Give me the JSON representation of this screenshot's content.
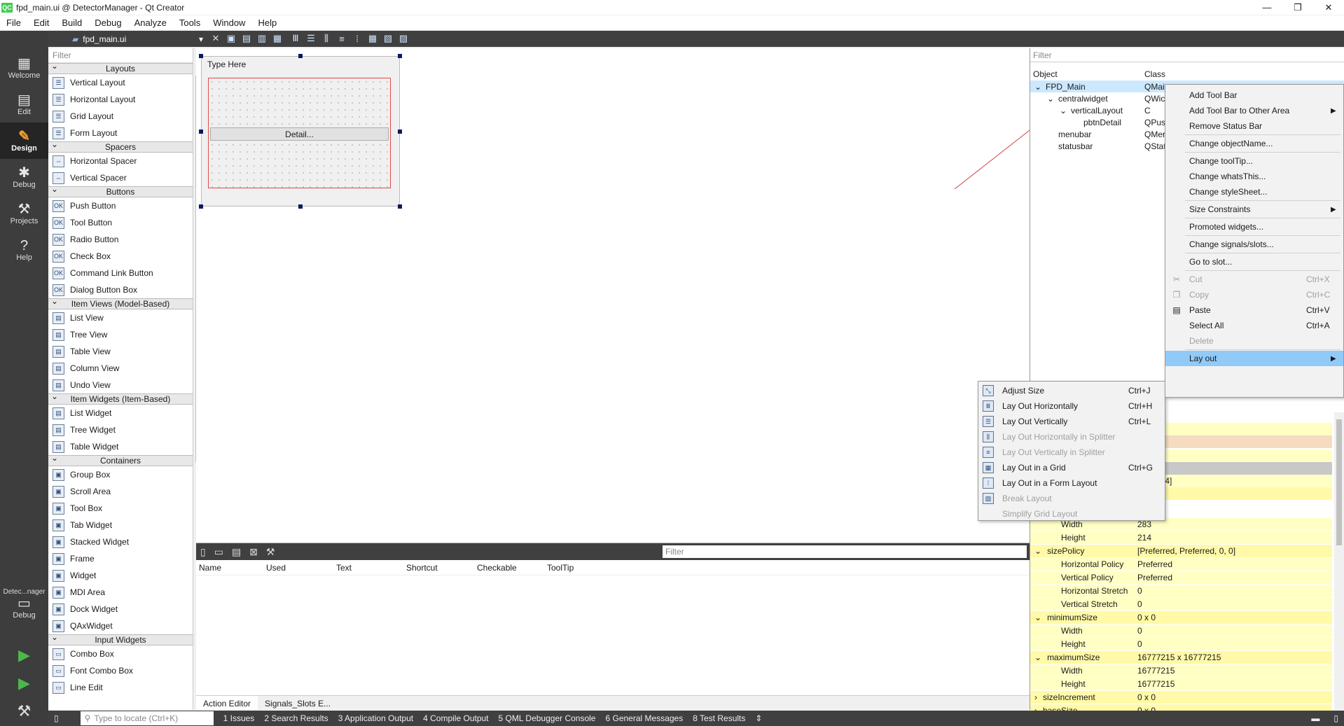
{
  "window": {
    "title": "fpd_main.ui @ DetectorManager - Qt Creator",
    "controls": [
      "—",
      "❐",
      "✕"
    ]
  },
  "menubar": [
    "File",
    "Edit",
    "Build",
    "Debug",
    "Analyze",
    "Tools",
    "Window",
    "Help"
  ],
  "modes": [
    {
      "label": "Welcome",
      "icon": "grid-icon"
    },
    {
      "label": "Edit",
      "icon": "edit-doc-icon"
    },
    {
      "label": "Design",
      "icon": "pencil-icon",
      "active": true
    },
    {
      "label": "Debug",
      "icon": "bug-icon"
    },
    {
      "label": "Projects",
      "icon": "wrench-icon"
    },
    {
      "label": "Help",
      "icon": "help-icon"
    }
  ],
  "kit": {
    "name": "Detec...nager",
    "mode": "Debug"
  },
  "editor": {
    "file_tab": "fpd_main.ui"
  },
  "widgetbox": {
    "filter_placeholder": "Filter",
    "categories": [
      {
        "name": "Layouts",
        "items": [
          "Vertical Layout",
          "Horizontal Layout",
          "Grid Layout",
          "Form Layout"
        ]
      },
      {
        "name": "Spacers",
        "items": [
          "Horizontal Spacer",
          "Vertical Spacer"
        ]
      },
      {
        "name": "Buttons",
        "items": [
          "Push Button",
          "Tool Button",
          "Radio Button",
          "Check Box",
          "Command Link Button",
          "Dialog Button Box"
        ]
      },
      {
        "name": "Item Views (Model-Based)",
        "items": [
          "List View",
          "Tree View",
          "Table View",
          "Column View",
          "Undo View"
        ]
      },
      {
        "name": "Item Widgets (Item-Based)",
        "items": [
          "List Widget",
          "Tree Widget",
          "Table Widget"
        ]
      },
      {
        "name": "Containers",
        "items": [
          "Group Box",
          "Scroll Area",
          "Tool Box",
          "Tab Widget",
          "Stacked Widget",
          "Frame",
          "Widget",
          "MDI Area",
          "Dock Widget",
          "QAxWidget"
        ]
      },
      {
        "name": "Input Widgets",
        "items": [
          "Combo Box",
          "Font Combo Box",
          "Line Edit"
        ]
      }
    ]
  },
  "form": {
    "menu_placeholder": "Type Here",
    "button_text": "Detail..."
  },
  "action_editor": {
    "filter_placeholder": "Filter",
    "columns": [
      "Name",
      "Used",
      "Text",
      "Shortcut",
      "Checkable",
      "ToolTip"
    ],
    "tabs": [
      "Action Editor",
      "Signals_Slots E..."
    ]
  },
  "object_inspector": {
    "filter_placeholder": "Filter",
    "headers": [
      "Object",
      "Class"
    ],
    "rows": [
      {
        "name": "FPD_Main",
        "class": "QMai",
        "indent": 0,
        "expander": "⌄"
      },
      {
        "name": "centralwidget",
        "class": "QWic",
        "indent": 1,
        "expander": "⌄"
      },
      {
        "name": "verticalLayout",
        "class": "C",
        "indent": 2,
        "expander": "⌄"
      },
      {
        "name": "pbtnDetail",
        "class": "QPus",
        "indent": 3,
        "expander": ""
      },
      {
        "name": "menubar",
        "class": "QMer",
        "indent": 1,
        "expander": ""
      },
      {
        "name": "statusbar",
        "class": "QStat",
        "indent": 1,
        "expander": ""
      }
    ]
  },
  "property_editor": {
    "partial": [
      "in",
      "83 x 214]"
    ],
    "rows": [
      {
        "name": "Width",
        "value": "283",
        "level": 2
      },
      {
        "name": "Height",
        "value": "214",
        "level": 2
      },
      {
        "name": "sizePolicy",
        "value": "[Preferred, Preferred, 0, 0]",
        "level": 1,
        "expander": "⌄"
      },
      {
        "name": "Horizontal Policy",
        "value": "Preferred",
        "level": 2
      },
      {
        "name": "Vertical Policy",
        "value": "Preferred",
        "level": 2
      },
      {
        "name": "Horizontal Stretch",
        "value": "0",
        "level": 2
      },
      {
        "name": "Vertical Stretch",
        "value": "0",
        "level": 2
      },
      {
        "name": "minimumSize",
        "value": "0 x 0",
        "level": 1,
        "expander": "⌄"
      },
      {
        "name": "Width",
        "value": "0",
        "level": 2
      },
      {
        "name": "Height",
        "value": "0",
        "level": 2
      },
      {
        "name": "maximumSize",
        "value": "16777215 x 16777215",
        "level": 1,
        "expander": "⌄"
      },
      {
        "name": "Width",
        "value": "16777215",
        "level": 2
      },
      {
        "name": "Height",
        "value": "16777215",
        "level": 2
      },
      {
        "name": "sizeIncrement",
        "value": "0 x 0",
        "level": 1,
        "expander": "›"
      },
      {
        "name": "baseSize",
        "value": "0 x 0",
        "level": 1,
        "expander": "›"
      }
    ]
  },
  "context_menu": {
    "items": [
      {
        "label": "Add Tool Bar"
      },
      {
        "label": "Add Tool Bar to Other Area",
        "submenu": true
      },
      {
        "label": "Remove Status Bar"
      },
      {
        "sep": true
      },
      {
        "label": "Change objectName..."
      },
      {
        "sep": true
      },
      {
        "label": "Change toolTip..."
      },
      {
        "label": "Change whatsThis..."
      },
      {
        "label": "Change styleSheet..."
      },
      {
        "sep": true
      },
      {
        "label": "Size Constraints",
        "submenu": true
      },
      {
        "sep": true
      },
      {
        "label": "Promoted widgets..."
      },
      {
        "sep": true
      },
      {
        "label": "Change signals/slots..."
      },
      {
        "sep": true
      },
      {
        "label": "Go to slot..."
      },
      {
        "sep": true
      },
      {
        "label": "Cut",
        "shortcut": "Ctrl+X",
        "disabled": true,
        "icon": "scissors-icon"
      },
      {
        "label": "Copy",
        "shortcut": "Ctrl+C",
        "disabled": true,
        "icon": "copy-icon"
      },
      {
        "label": "Paste",
        "shortcut": "Ctrl+V",
        "icon": "paste-icon"
      },
      {
        "label": "Select All",
        "shortcut": "Ctrl+A"
      },
      {
        "label": "Delete",
        "disabled": true
      },
      {
        "sep": true
      },
      {
        "label": "Lay out",
        "submenu": true,
        "selected": true
      }
    ]
  },
  "layout_submenu": {
    "items": [
      {
        "label": "Adjust Size",
        "shortcut": "Ctrl+J",
        "icon": "adjust-size-icon"
      },
      {
        "label": "Lay Out Horizontally",
        "shortcut": "Ctrl+H",
        "icon": "hlayout-icon"
      },
      {
        "label": "Lay Out Vertically",
        "shortcut": "Ctrl+L",
        "icon": "vlayout-icon"
      },
      {
        "label": "Lay Out Horizontally in Splitter",
        "disabled": true,
        "icon": "hsplitter-icon"
      },
      {
        "label": "Lay Out Vertically in Splitter",
        "disabled": true,
        "icon": "vsplitter-icon"
      },
      {
        "label": "Lay Out in a Grid",
        "shortcut": "Ctrl+G",
        "icon": "grid-layout-icon"
      },
      {
        "label": "Lay Out in a Form Layout",
        "icon": "form-layout-icon"
      },
      {
        "label": "Break Layout",
        "disabled": true,
        "icon": "break-layout-icon"
      },
      {
        "label": "Simplify Grid Layout",
        "disabled": true
      }
    ]
  },
  "statusbar": {
    "locate_placeholder": "Type to locate (Ctrl+K)",
    "panes": [
      "1  Issues",
      "2  Search Results",
      "3  Application Output",
      "4  Compile Output",
      "5  QML Debugger Console",
      "6  General Messages",
      "8  Test Results"
    ]
  }
}
